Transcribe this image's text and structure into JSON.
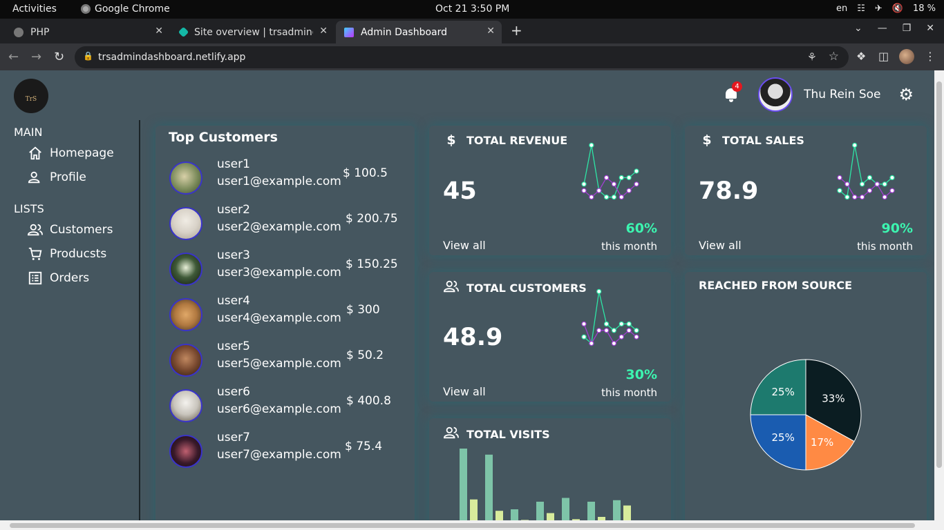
{
  "os": {
    "activities": "Activities",
    "app_name": "Google Chrome",
    "clock": "Oct 21  3:50 PM",
    "lang": "en",
    "battery": "18 %"
  },
  "browser": {
    "tabs": [
      {
        "title": "PHP",
        "favicon_color": "#777777"
      },
      {
        "title": "Site overview | trsadmindashboard",
        "favicon_color": "#14b8a6"
      },
      {
        "title": "Admin Dashboard",
        "favicon_color": "#a855f7"
      }
    ],
    "url": "trsadmindashboard.netlify.app"
  },
  "header": {
    "logo_text": "TrS",
    "notification_count": "4",
    "user_name": "Thu Rein Soe"
  },
  "sidebar": {
    "main_title": "MAIN",
    "main_items": [
      {
        "label": "Homepage",
        "icon": "home-icon"
      },
      {
        "label": "Profile",
        "icon": "user-icon"
      }
    ],
    "lists_title": "LISTS",
    "list_items": [
      {
        "label": "Customers",
        "icon": "users-icon"
      },
      {
        "label": "Producsts",
        "icon": "cart-icon"
      },
      {
        "label": "Orders",
        "icon": "list-icon"
      }
    ]
  },
  "top_customers": {
    "title": "Top Customers",
    "rows": [
      {
        "name": "user1",
        "email": "user1@example.com",
        "amount": "$ 100.5",
        "avatar_color": "#7a8a5a"
      },
      {
        "name": "user2",
        "email": "user2@example.com",
        "amount": "$ 200.75",
        "avatar_color": "#d8d2c8"
      },
      {
        "name": "user3",
        "email": "user3@example.com",
        "amount": "$ 150.25",
        "avatar_color": "#3f5a38"
      },
      {
        "name": "user4",
        "email": "user4@example.com",
        "amount": "$ 300",
        "avatar_color": "#b07840"
      },
      {
        "name": "user5",
        "email": "user5@example.com",
        "amount": "$ 50.2",
        "avatar_color": "#7a4a30"
      },
      {
        "name": "user6",
        "email": "user6@example.com",
        "amount": "$ 400.8",
        "avatar_color": "#c8c4bc"
      },
      {
        "name": "user7",
        "email": "user7@example.com",
        "amount": "$ 75.4",
        "avatar_color": "#3a1a2a"
      }
    ]
  },
  "stats": {
    "revenue": {
      "title": "TOTAL REVENUE",
      "icon": "dollar-icon",
      "value": "45",
      "percent": "60%",
      "view_all": "View all",
      "period": "this month"
    },
    "sales": {
      "title": "TOTAL SALES",
      "icon": "dollar-icon",
      "value": "78.9",
      "percent": "90%",
      "view_all": "View all",
      "period": "this month"
    },
    "customers": {
      "title": "TOTAL CUSTOMERS",
      "icon": "users-icon",
      "value": "48.9",
      "percent": "30%",
      "view_all": "View all",
      "period": "this month"
    },
    "visits": {
      "title": "TOTAL VISITS",
      "icon": "users-icon"
    }
  },
  "source": {
    "title": "REACHED FROM SOURCE"
  },
  "colors": {
    "page_bg": "#45565f",
    "accent_green": "#3cf5b0",
    "spark_green": "#2ee6a6",
    "spark_purple": "#a23fd2",
    "bar_teal": "#7ec4a8",
    "bar_yellow": "#d8ec9c"
  },
  "chart_data": [
    {
      "type": "line",
      "name": "revenue-sparkline",
      "series": [
        {
          "values": [
            3,
            9,
            2,
            1,
            1,
            4,
            4,
            5
          ]
        },
        {
          "values": [
            2,
            1,
            2,
            4,
            3,
            1,
            2,
            3
          ]
        }
      ]
    },
    {
      "type": "line",
      "name": "sales-sparkline",
      "series": [
        {
          "values": [
            2,
            1,
            9,
            3,
            4,
            3,
            3,
            4
          ]
        },
        {
          "values": [
            4,
            3,
            1,
            1,
            2,
            3,
            1,
            2
          ]
        }
      ]
    },
    {
      "type": "line",
      "name": "customers-sparkline",
      "series": [
        {
          "values": [
            2,
            1,
            9,
            4,
            3,
            4,
            4,
            3
          ]
        },
        {
          "values": [
            4,
            1,
            3,
            3,
            1,
            2,
            3,
            2
          ]
        }
      ]
    },
    {
      "type": "bar",
      "name": "total-visits",
      "series": [
        {
          "values": [
            100,
            92,
            20,
            30,
            35,
            30,
            32
          ]
        },
        {
          "values": [
            33,
            18,
            6,
            15,
            7,
            10,
            25
          ]
        }
      ]
    },
    {
      "type": "pie",
      "name": "reached-from-source",
      "slices": [
        {
          "label": "33%",
          "value": 33,
          "color": "#0b1d22"
        },
        {
          "label": "17%",
          "value": 17,
          "color": "#ff8a44"
        },
        {
          "label": "25%",
          "value": 25,
          "color": "#1a5cb0"
        },
        {
          "label": "25%",
          "value": 25,
          "color": "#1d7a6e"
        }
      ]
    }
  ]
}
